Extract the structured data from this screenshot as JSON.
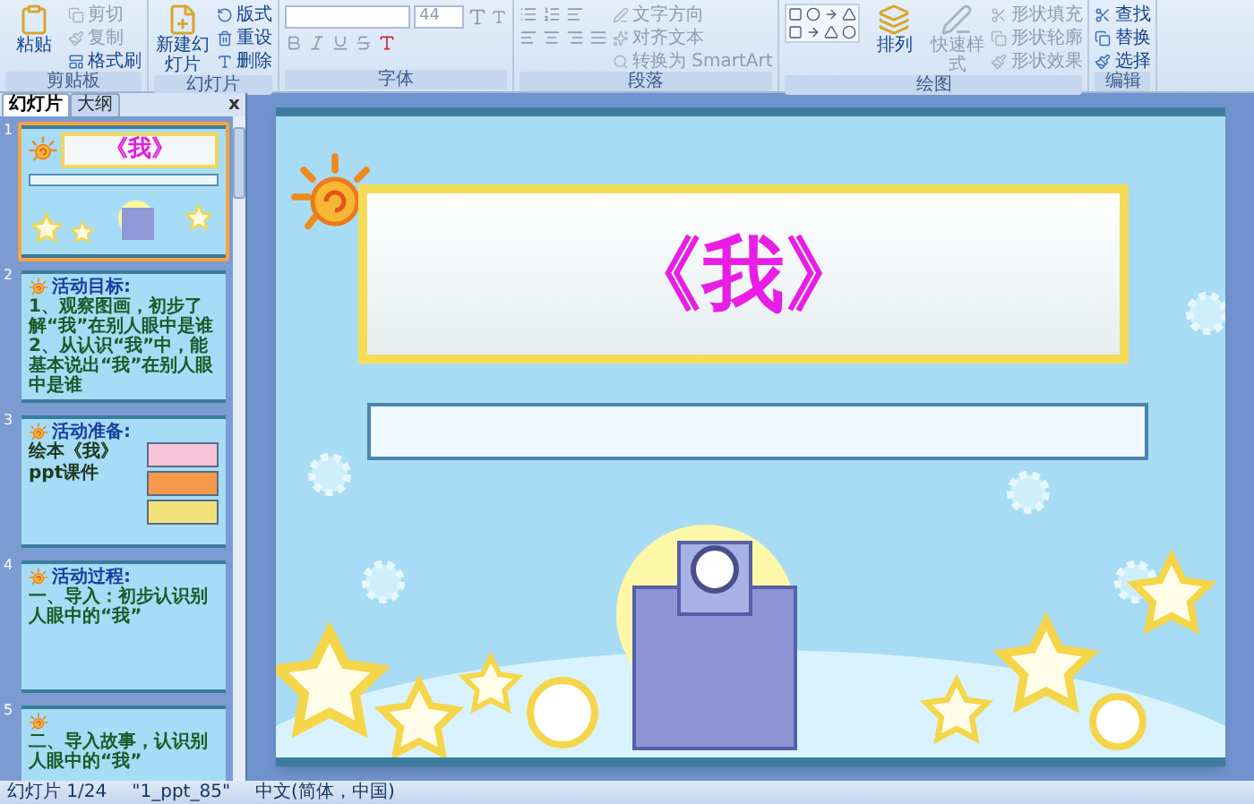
{
  "ribbon": {
    "groups": [
      {
        "label": "剪贴板",
        "items": [
          {
            "kind": "large",
            "label": "粘贴"
          },
          {
            "kind": "small",
            "label": "剪切",
            "disabled": true
          },
          {
            "kind": "small",
            "label": "复制",
            "disabled": true
          },
          {
            "kind": "small",
            "label": "格式刷",
            "disabled": false
          }
        ]
      },
      {
        "label": "幻灯片",
        "items": [
          {
            "kind": "large",
            "label": "新建幻灯片"
          },
          {
            "kind": "small",
            "label": "版式",
            "disabled": false
          },
          {
            "kind": "small",
            "label": "重设",
            "disabled": false
          },
          {
            "kind": "small",
            "label": "删除",
            "disabled": false
          }
        ]
      },
      {
        "label": "字体",
        "items": [
          {
            "kind": "fontbar",
            "size": "44"
          }
        ]
      },
      {
        "label": "段落",
        "items": [
          {
            "kind": "parabar"
          },
          {
            "kind": "small",
            "label": "文字方向",
            "disabled": true
          },
          {
            "kind": "small",
            "label": "对齐文本",
            "disabled": true
          },
          {
            "kind": "small",
            "label": "转换为 SmartArt",
            "disabled": true
          }
        ]
      },
      {
        "label": "绘图",
        "items": [
          {
            "kind": "shapes"
          },
          {
            "kind": "large",
            "label": "排列"
          },
          {
            "kind": "large",
            "label": "快速样式",
            "disabled": true
          },
          {
            "kind": "small",
            "label": "形状填充",
            "disabled": true
          },
          {
            "kind": "small",
            "label": "形状轮廓",
            "disabled": true
          },
          {
            "kind": "small",
            "label": "形状效果",
            "disabled": true
          }
        ]
      },
      {
        "label": "编辑",
        "items": [
          {
            "kind": "small",
            "label": "查找",
            "disabled": false
          },
          {
            "kind": "small",
            "label": "替换",
            "disabled": false
          },
          {
            "kind": "small",
            "label": "选择",
            "disabled": false
          }
        ]
      }
    ]
  },
  "slide_panel": {
    "tabs": [
      {
        "label": "幻灯片",
        "selected": true
      },
      {
        "label": "大纲",
        "selected": false
      }
    ],
    "close": "x",
    "slides": [
      {
        "number": "1",
        "selected": true,
        "kind": "title",
        "title": "《我》"
      },
      {
        "number": "2",
        "selected": false,
        "kind": "text",
        "title": "活动目标:",
        "lines": [
          "1、观察图画，初步了解“我”在别人眼中是谁",
          "2、从认识“我”中，能基本说出“我”在别人眼中是谁"
        ]
      },
      {
        "number": "3",
        "selected": false,
        "kind": "pictures",
        "title": "活动准备:",
        "lines": [
          "绘本《我》",
          "ppt课件"
        ]
      },
      {
        "number": "4",
        "selected": false,
        "kind": "text",
        "title": "活动过程:",
        "lines": [
          "一、导入：初步认识别人眼中的“我”"
        ]
      },
      {
        "number": "5",
        "selected": false,
        "kind": "text",
        "lines": [
          "二、导入故事，认识别人眼中的“我”"
        ]
      }
    ]
  },
  "slide": {
    "title": "《我》"
  },
  "status_bar": [
    "幻灯片 1/24",
    "\"1_ppt_85\"",
    "中文(简体，中国)"
  ]
}
